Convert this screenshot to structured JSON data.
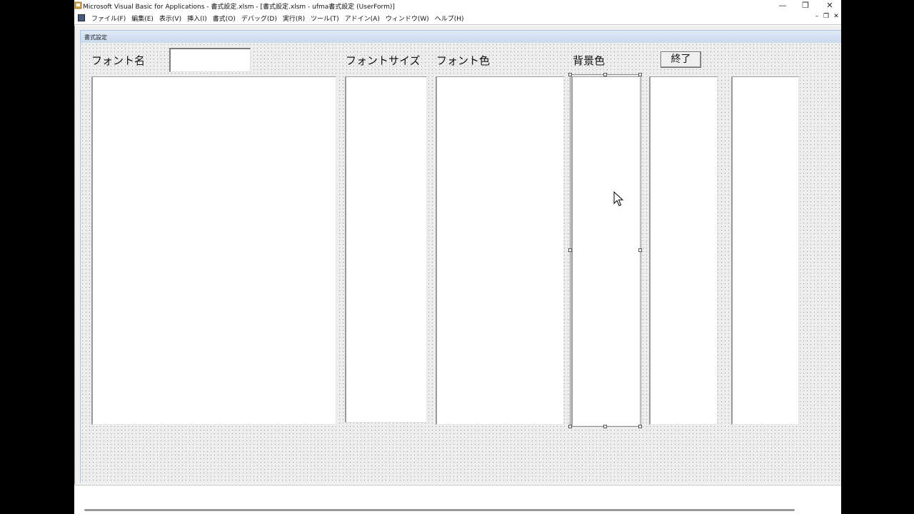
{
  "window": {
    "title": "Microsoft Visual Basic for Applications - 書式設定.xlsm - [書式設定.xlsm - ufma書式設定 (UserForm)]",
    "controls": {
      "minimize": "—",
      "restore": "❐",
      "close": "✕"
    }
  },
  "menubar": {
    "items": [
      "ファイル(F)",
      "編集(E)",
      "表示(V)",
      "挿入(I)",
      "書式(O)",
      "デバッグ(D)",
      "実行(R)",
      "ツール(T)",
      "アドイン(A)",
      "ウィンドウ(W)",
      "ヘルプ(H)"
    ],
    "mdi_controls": {
      "minimize": "–",
      "restore": "❐",
      "close": "✕"
    }
  },
  "userform": {
    "caption": "書式設定",
    "labels": {
      "font_name": "フォント名",
      "font_size": "フォントサイズ",
      "font_color": "フォント色",
      "background_color": "背景色"
    },
    "font_name_input": {
      "value": ""
    },
    "end_button": "終了",
    "listboxes": [
      "font-name-list",
      "font-size-list",
      "font-color-list",
      "background-color-list",
      "extra-list-1",
      "extra-list-2"
    ]
  },
  "icons": {
    "app": "vba-app-icon",
    "document": "userform-doc-icon",
    "cursor": "mouse-pointer-icon"
  }
}
